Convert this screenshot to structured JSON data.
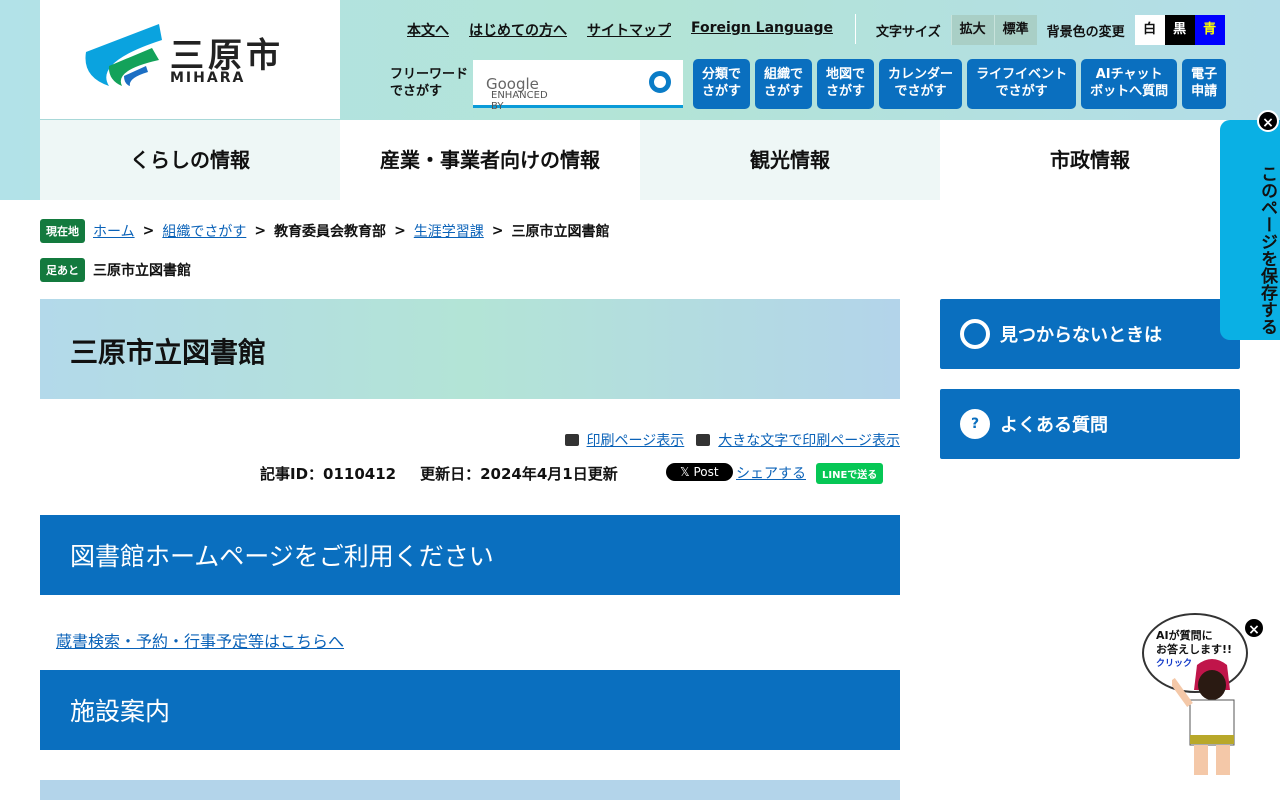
{
  "logo": {
    "title": "三原市",
    "subtitle": "MIHARA"
  },
  "top_links": [
    "本文へ",
    "はじめての方へ",
    "サイトマップ",
    "Foreign Language"
  ],
  "font_size": {
    "label": "文字サイズ",
    "large": "拡大",
    "standard": "標準"
  },
  "bg_color": {
    "label": "背景色の変更",
    "white": "白",
    "black": "黒",
    "blue": "青"
  },
  "search": {
    "label": "フリーワードでさがす",
    "enhanced": "ENHANCED BY",
    "google": "Google"
  },
  "quick_buttons": [
    "分類で\nさがす",
    "組織で\nさがす",
    "地図で\nさがす",
    "カレンダー\nでさがす",
    "ライフイベント\nでさがす",
    "AIチャット\nボットへ質問",
    "電子\n申請"
  ],
  "nav": [
    "くらしの情報",
    "産業・事業者向けの情報",
    "観光情報",
    "市政情報"
  ],
  "breadcrumb": {
    "tag": "現在地",
    "items": [
      "ホーム",
      "組織でさがす",
      "教育委員会教育部",
      "生涯学習課",
      "三原市立図書館"
    ]
  },
  "footprint": {
    "tag": "足あと",
    "item": "三原市立図書館"
  },
  "page_title": "三原市立図書館",
  "print": {
    "normal": "印刷ページ表示",
    "large": "大きな文字で印刷ページ表示"
  },
  "meta": {
    "id": "記事ID：0110412",
    "updated": "更新日：2024年4月1日更新"
  },
  "social": {
    "x": "𝕏 Post",
    "share": "シェアする",
    "line": "LINEで送る"
  },
  "sections": [
    {
      "heading": "図書館ホームページをご利用ください",
      "link": "蔵書検索・予約・行事予定等はこちらへ"
    },
    {
      "heading": "施設案内"
    }
  ],
  "side": {
    "notfound": "見つからないときは",
    "faq": "よくある質問"
  },
  "save_page": "このページを保存する",
  "ai_bubble": {
    "line1": "AIが質問に",
    "line2": "お答えします!!",
    "click": "クリック"
  }
}
